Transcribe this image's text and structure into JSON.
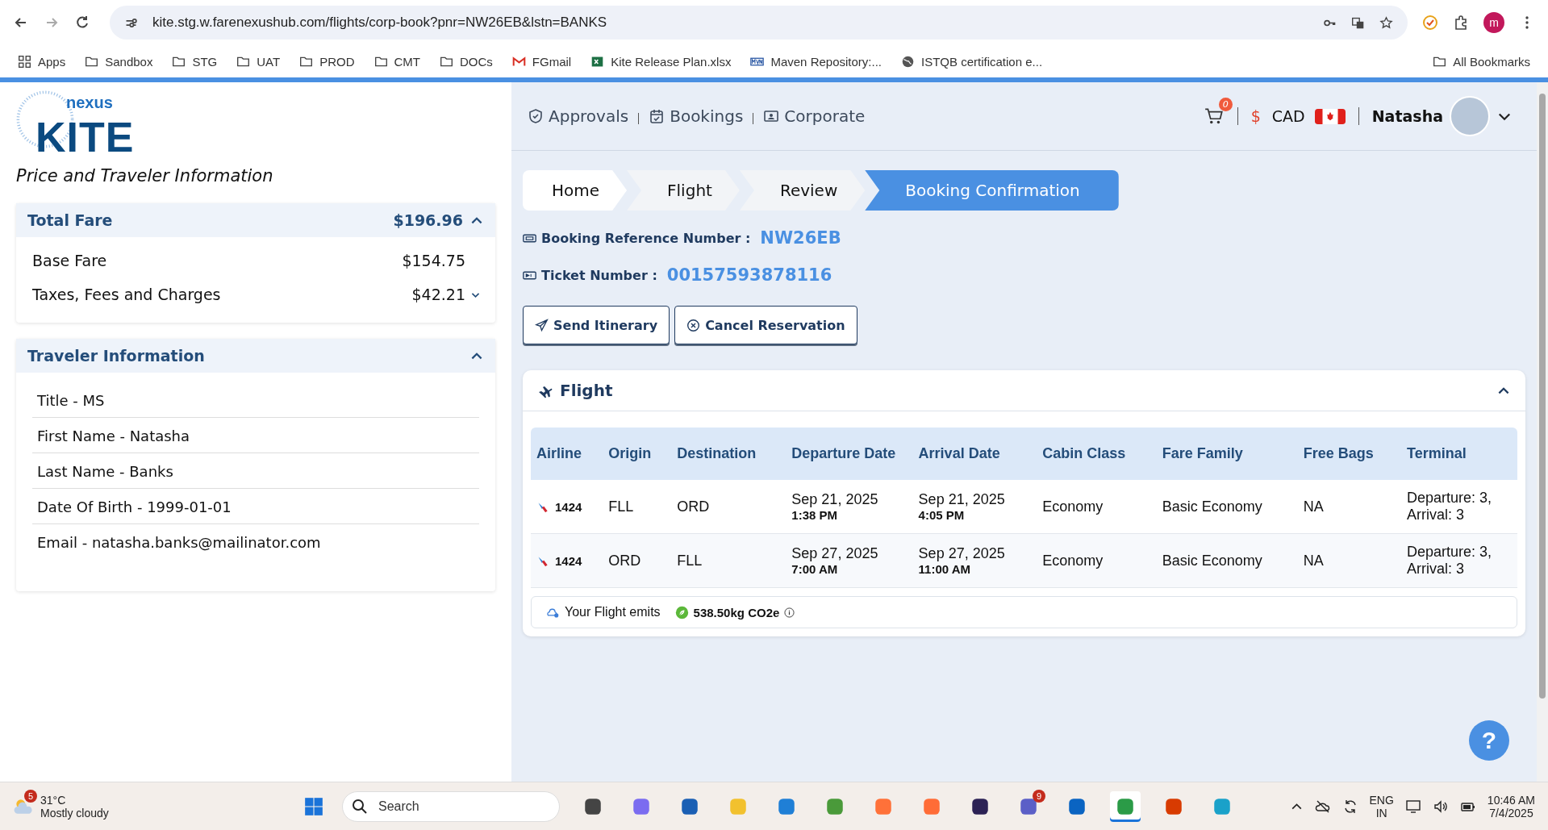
{
  "browser": {
    "url": "kite.stg.w.farenexushub.com/flights/corp-book?pnr=NW26EB&lstn=BANKS",
    "profile": "m",
    "bookmarks": [
      {
        "kind": "apps",
        "label": "Apps"
      },
      {
        "kind": "folder",
        "label": "Sandbox"
      },
      {
        "kind": "folder",
        "label": "STG"
      },
      {
        "kind": "folder",
        "label": "UAT"
      },
      {
        "kind": "folder",
        "label": "PROD"
      },
      {
        "kind": "folder",
        "label": "CMT"
      },
      {
        "kind": "folder",
        "label": "DOCs"
      },
      {
        "kind": "mail",
        "label": "FGmail"
      },
      {
        "kind": "sheet",
        "label": "Kite Release Plan.xlsx"
      },
      {
        "kind": "maven",
        "label": "Maven Repository:..."
      },
      {
        "kind": "globe",
        "label": "ISTQB certification e..."
      }
    ],
    "all_bookmarks": "All Bookmarks"
  },
  "sidebar": {
    "logo_small": "nexus",
    "logo_big": "KITE",
    "heading": "Price and Traveler Information",
    "fare": {
      "title": "Total Fare",
      "total": "$196.96",
      "expanded": true,
      "lines": [
        {
          "label": "Base Fare",
          "amount": "$154.75",
          "kind": "plain"
        },
        {
          "label": "Taxes, Fees and Charges",
          "amount": "$42.21",
          "kind": "expandable",
          "expanded": false
        }
      ]
    },
    "traveler": {
      "title": "Traveler Information",
      "expanded": true,
      "fields": [
        "Title - MS",
        "First Name - Natasha",
        "Last Name - Banks",
        "Date Of Birth - 1999-01-01",
        "Email - natasha.banks@mailinator.com"
      ]
    }
  },
  "header": {
    "nav": [
      {
        "kind": "approvals",
        "label": "Approvals"
      },
      {
        "kind": "bookings",
        "label": "Bookings"
      },
      {
        "kind": "corporate",
        "label": "Corporate"
      }
    ],
    "cart_count": "0",
    "currency_symbol": "$",
    "currency": "CAD",
    "user": "Natasha"
  },
  "breadcrumb": [
    {
      "label": "Home",
      "selected": false
    },
    {
      "label": "Flight",
      "selected": false
    },
    {
      "label": "Review",
      "selected": false
    },
    {
      "label": "Booking Confirmation",
      "selected": true
    }
  ],
  "booking": {
    "ref_label": "Booking Reference Number :",
    "ref": "NW26EB",
    "ticket_label": "Ticket Number :",
    "ticket": "00157593878116"
  },
  "actions": [
    {
      "kind": "send",
      "label": "Send Itinerary"
    },
    {
      "kind": "cancel",
      "label": "Cancel Reservation"
    }
  ],
  "flight": {
    "title": "Flight",
    "expanded": true,
    "columns": [
      "Airline",
      "Origin",
      "Destination",
      "Departure Date",
      "Arrival Date",
      "Cabin Class",
      "Fare Family",
      "Free Bags",
      "Terminal"
    ],
    "rows": [
      {
        "flight_no": "1424",
        "origin": "FLL",
        "destination": "ORD",
        "dep_date": "Sep 21, 2025",
        "dep_time": "1:38 PM",
        "arr_date": "Sep 21, 2025",
        "arr_time": "4:05 PM",
        "cabin": "Economy",
        "fare_family": "Basic Economy",
        "bags": "NA",
        "terminal": "Departure: 3, Arrival: 3"
      },
      {
        "flight_no": "1424",
        "origin": "ORD",
        "destination": "FLL",
        "dep_date": "Sep 27, 2025",
        "dep_time": "7:00 AM",
        "arr_date": "Sep 27, 2025",
        "arr_time": "11:00 AM",
        "cabin": "Economy",
        "fare_family": "Basic Economy",
        "bags": "NA",
        "terminal": "Departure: 3, Arrival: 3"
      }
    ],
    "emits_label": "Your Flight emits",
    "emission": "538.50kg CO2e"
  },
  "help": "?",
  "taskbar": {
    "weather_badge": "5",
    "temperature": "31°C",
    "weather": "Mostly cloudy",
    "search": {
      "placeholder": "Search"
    },
    "apps": [
      {
        "kind": "files"
      },
      {
        "kind": "copilot"
      },
      {
        "kind": "store"
      },
      {
        "kind": "explorer"
      },
      {
        "kind": "vscode"
      },
      {
        "kind": "notepad"
      },
      {
        "kind": "firefox"
      },
      {
        "kind": "postman"
      },
      {
        "kind": "eclipse"
      },
      {
        "kind": "teams",
        "badge": "9"
      },
      {
        "kind": "outlook"
      },
      {
        "kind": "chrome",
        "selected": true
      },
      {
        "kind": "office"
      },
      {
        "kind": "edge"
      }
    ],
    "lang": "ENG",
    "region": "IN",
    "time": "10:46 AM",
    "date": "7/4/2025"
  }
}
